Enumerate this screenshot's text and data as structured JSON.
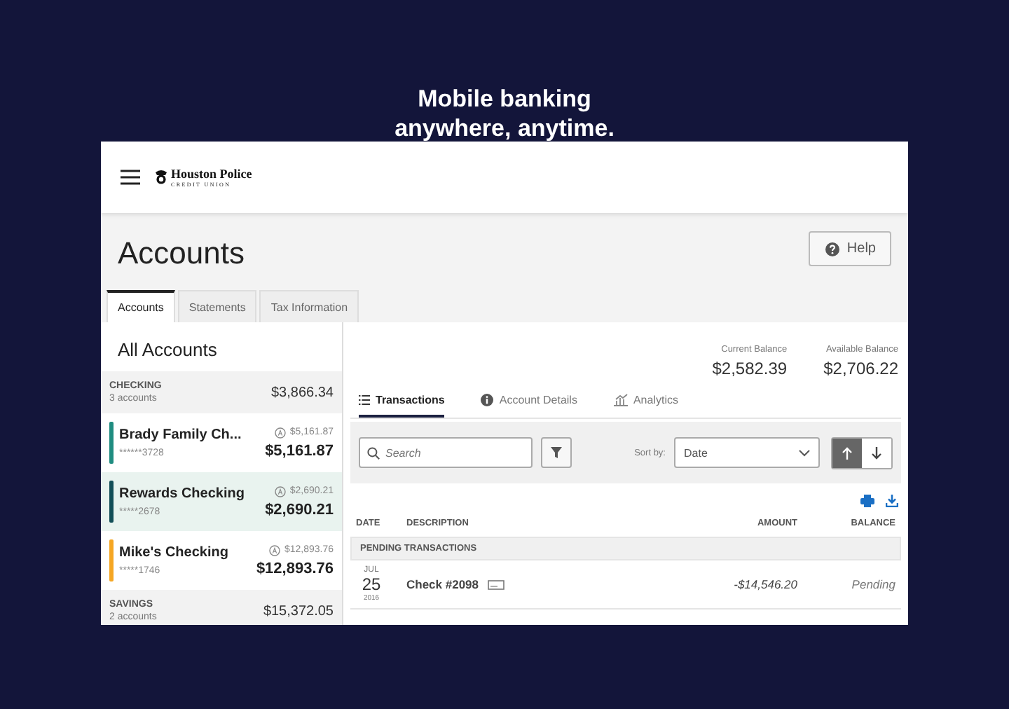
{
  "headline": [
    "Mobile banking",
    "anywhere, anytime."
  ],
  "logo": {
    "name": "Houston Police",
    "subtitle": "CREDIT UNION"
  },
  "page_title": "Accounts",
  "help_button": "Help",
  "tabs": [
    {
      "label": "Accounts",
      "selected": true
    },
    {
      "label": "Statements",
      "selected": false
    },
    {
      "label": "Tax Information",
      "selected": false
    }
  ],
  "sidebar": {
    "title": "All Accounts",
    "groups": [
      {
        "name": "CHECKING",
        "count": "3 accounts",
        "total": "$3,866.34",
        "accounts": [
          {
            "name": "Brady Family Ch...",
            "number": "******3728",
            "available": "$5,161.87",
            "balance": "$5,161.87",
            "color": "#1f8c80",
            "selected": false
          },
          {
            "name": "Rewards Checking",
            "number": "*****2678",
            "available": "$2,690.21",
            "balance": "$2,690.21",
            "color": "#124e57",
            "selected": true
          },
          {
            "name": "Mike's Checking",
            "number": "*****1746",
            "available": "$12,893.76",
            "balance": "$12,893.76",
            "color": "#f5a623",
            "selected": false
          }
        ]
      },
      {
        "name": "SAVINGS",
        "count": "2 accounts",
        "total": "$15,372.05"
      }
    ]
  },
  "balances": [
    {
      "label": "Current Balance",
      "value": "$2,582.39"
    },
    {
      "label": "Available Balance",
      "value": "$2,706.22"
    }
  ],
  "detail_tabs": [
    {
      "label": "Transactions",
      "kind": "list",
      "selected": true
    },
    {
      "label": "Account Details",
      "kind": "info",
      "selected": false
    },
    {
      "label": "Analytics",
      "kind": "chart",
      "selected": false
    }
  ],
  "toolbar": {
    "search_placeholder": "Search",
    "sort_label": "Sort by:",
    "sort_value": "Date",
    "sort_directions": [
      {
        "kind": "up",
        "selected": true
      },
      {
        "kind": "down",
        "selected": false
      }
    ]
  },
  "table": {
    "columns": [
      "DATE",
      "DESCRIPTION",
      "AMOUNT",
      "BALANCE"
    ],
    "sections": [
      {
        "title": "PENDING TRANSACTIONS",
        "rows": [
          {
            "month": "JUL",
            "day": "25",
            "year": "2016",
            "description": "Check #2098",
            "amount": "-$14,546.20",
            "balance": "Pending"
          }
        ]
      }
    ]
  }
}
